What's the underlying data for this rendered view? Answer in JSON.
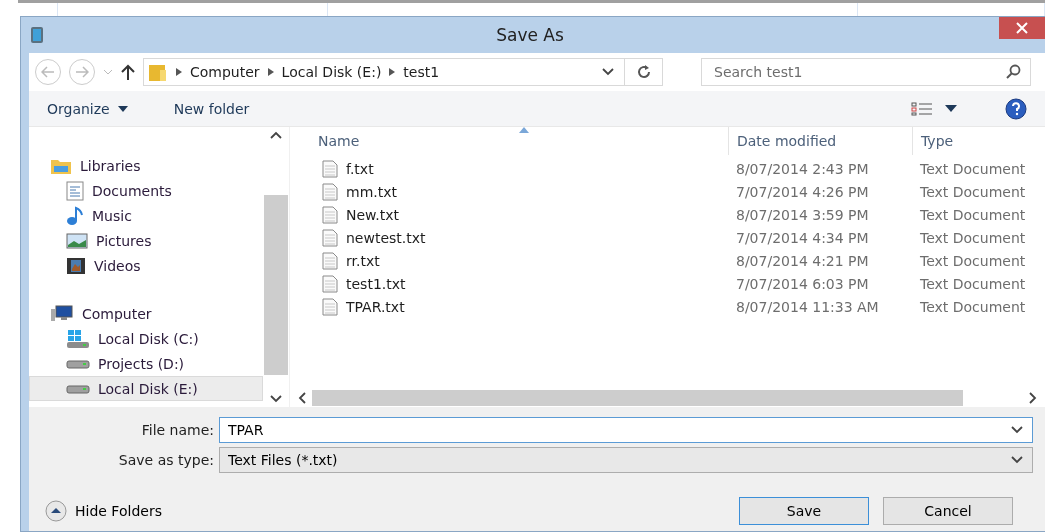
{
  "window": {
    "title": "Save As"
  },
  "address": {
    "path": [
      "Computer",
      "Local Disk (E:)",
      "test1"
    ]
  },
  "search": {
    "placeholder": "Search test1"
  },
  "toolbar": {
    "organize": "Organize",
    "new_folder": "New folder"
  },
  "nav": [
    {
      "label": "Libraries",
      "kind": "libraries",
      "selected": false,
      "children": [
        {
          "label": "Documents",
          "kind": "documents",
          "selected": false
        },
        {
          "label": "Music",
          "kind": "music",
          "selected": false
        },
        {
          "label": "Pictures",
          "kind": "pictures",
          "selected": false
        },
        {
          "label": "Videos",
          "kind": "videos",
          "selected": false
        }
      ]
    },
    {
      "label": "Computer",
      "kind": "computer",
      "selected": false,
      "children": [
        {
          "label": "Local Disk (C:)",
          "kind": "system-disk",
          "selected": false
        },
        {
          "label": "Projects (D:)",
          "kind": "disk",
          "selected": false
        },
        {
          "label": "Local Disk (E:)",
          "kind": "disk",
          "selected": true
        }
      ]
    }
  ],
  "table": {
    "columns": [
      {
        "label": "Name",
        "sorted": true
      },
      {
        "label": "Date modified",
        "sorted": false
      },
      {
        "label": "Type",
        "sorted": false
      }
    ],
    "rows": [
      {
        "name": "f.txt",
        "date": "8/07/2014 2:43 PM",
        "type": "Text Document"
      },
      {
        "name": "mm.txt",
        "date": "7/07/2014 4:26 PM",
        "type": "Text Document"
      },
      {
        "name": "New.txt",
        "date": "8/07/2014 3:59 PM",
        "type": "Text Document"
      },
      {
        "name": "newtest.txt",
        "date": "7/07/2014 4:34 PM",
        "type": "Text Document"
      },
      {
        "name": "rr.txt",
        "date": "8/07/2014 4:21 PM",
        "type": "Text Document"
      },
      {
        "name": "test1.txt",
        "date": "7/07/2014 6:03 PM",
        "type": "Text Document"
      },
      {
        "name": "TPAR.txt",
        "date": "8/07/2014 11:33 AM",
        "type": "Text Document"
      }
    ]
  },
  "fields": [
    {
      "label": "File name:",
      "value": "TPAR",
      "focused": true
    },
    {
      "label": "Save as type:",
      "value": "Text Files (*.txt)",
      "focused": false
    }
  ],
  "hide_folders": "Hide Folders",
  "buttons": [
    {
      "label": "Save",
      "default": true
    },
    {
      "label": "Cancel",
      "default": false
    }
  ]
}
